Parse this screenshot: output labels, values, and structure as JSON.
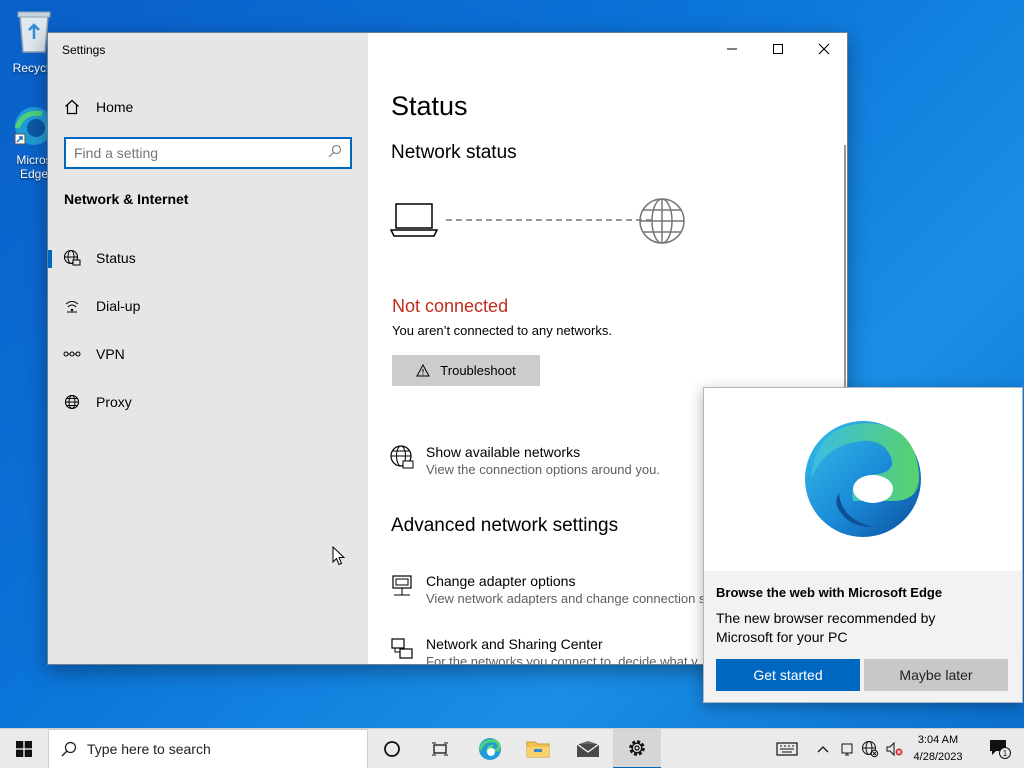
{
  "desktop": {
    "icons": [
      {
        "label": "Recycle"
      },
      {
        "label": "Micros Edge"
      }
    ]
  },
  "window": {
    "title": "Settings",
    "sidebar": {
      "home_label": "Home",
      "search_placeholder": "Find a setting",
      "section_title": "Network & Internet",
      "items": [
        {
          "label": "Status",
          "icon": "globe-network-icon",
          "active": true
        },
        {
          "label": "Dial-up",
          "icon": "dialup-icon",
          "active": false
        },
        {
          "label": "VPN",
          "icon": "vpn-icon",
          "active": false
        },
        {
          "label": "Proxy",
          "icon": "globe-icon",
          "active": false
        }
      ]
    },
    "content": {
      "page_title": "Status",
      "network_status_heading": "Network status",
      "connection_state": "Not connected",
      "connection_detail": "You aren’t connected to any networks.",
      "troubleshoot_label": "Troubleshoot",
      "show_networks": {
        "title": "Show available networks",
        "subtitle": "View the connection options around you."
      },
      "advanced_heading": "Advanced network settings",
      "adapter_options": {
        "title": "Change adapter options",
        "subtitle": "View network adapters and change connection s"
      },
      "sharing_center": {
        "title": "Network and Sharing Center",
        "subtitle": "For the networks you connect to, decide what v"
      }
    }
  },
  "edge_popup": {
    "title": "Browse the web with Microsoft Edge",
    "body": "The new browser recommended by Microsoft for your PC",
    "primary_button": "Get started",
    "secondary_button": "Maybe later"
  },
  "taskbar": {
    "search_placeholder": "Type here to search",
    "time": "3:04 AM",
    "date": "4/28/2023",
    "notification_count": "1"
  },
  "colors": {
    "accent": "#0067c0",
    "error": "#c42b1c",
    "desktop": "#0b74d8"
  }
}
